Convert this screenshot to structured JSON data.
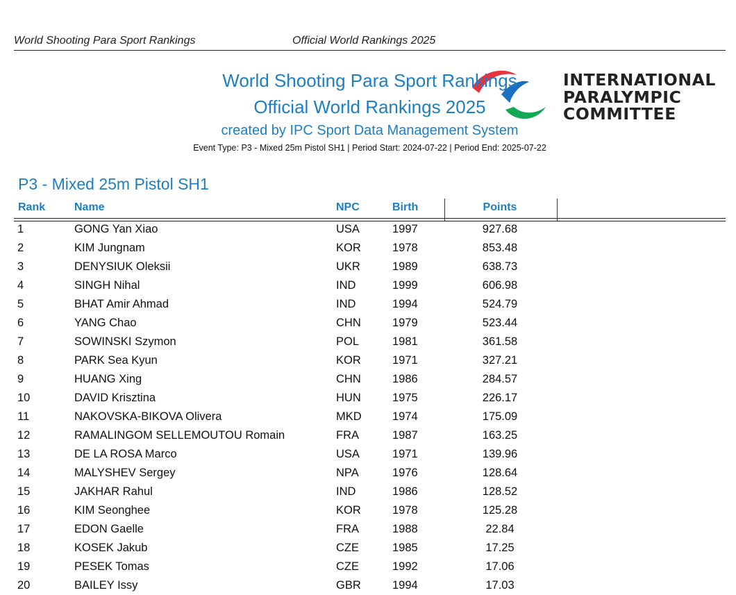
{
  "header": {
    "left_text": "World Shooting Para Sport Rankings",
    "center_text": "Official World Rankings 2025"
  },
  "title": {
    "line1": "World Shooting Para Sport Rankings",
    "line2": "Official World Rankings 2025",
    "line3": "created by IPC Sport Data Management System",
    "event_info": "Event Type: P3 - Mixed 25m Pistol SH1 | Period Start: 2024-07-22 | Period End: 2025-07-22"
  },
  "logo": {
    "lines": [
      "INTERNATIONAL",
      "PARALYMPIC",
      "COMMITTEE"
    ],
    "colors": {
      "red": "#e8333f",
      "blue": "#1e6fc0",
      "green": "#12a854"
    }
  },
  "section": {
    "title": "P3 - Mixed 25m Pistol SH1"
  },
  "table": {
    "columns": {
      "rank": "Rank",
      "name": "Name",
      "npc": "NPC",
      "birth": "Birth",
      "points": "Points"
    },
    "rows": [
      {
        "rank": "1",
        "name": "GONG Yan Xiao",
        "npc": "USA",
        "birth": "1997",
        "points": "927.68"
      },
      {
        "rank": "2",
        "name": "KIM Jungnam",
        "npc": "KOR",
        "birth": "1978",
        "points": "853.48"
      },
      {
        "rank": "3",
        "name": "DENYSIUK Oleksii",
        "npc": "UKR",
        "birth": "1989",
        "points": "638.73"
      },
      {
        "rank": "4",
        "name": "SINGH Nihal",
        "npc": "IND",
        "birth": "1999",
        "points": "606.98"
      },
      {
        "rank": "5",
        "name": "BHAT Amir Ahmad",
        "npc": "IND",
        "birth": "1994",
        "points": "524.79"
      },
      {
        "rank": "6",
        "name": "YANG Chao",
        "npc": "CHN",
        "birth": "1979",
        "points": "523.44"
      },
      {
        "rank": "7",
        "name": "SOWINSKI Szymon",
        "npc": "POL",
        "birth": "1981",
        "points": "361.58"
      },
      {
        "rank": "8",
        "name": "PARK Sea Kyun",
        "npc": "KOR",
        "birth": "1971",
        "points": "327.21"
      },
      {
        "rank": "9",
        "name": "HUANG Xing",
        "npc": "CHN",
        "birth": "1986",
        "points": "284.57"
      },
      {
        "rank": "10",
        "name": "DAVID Krisztina",
        "npc": "HUN",
        "birth": "1975",
        "points": "226.17"
      },
      {
        "rank": "11",
        "name": "NAKOVSKA-BIKOVA Olivera",
        "npc": "MKD",
        "birth": "1974",
        "points": "175.09"
      },
      {
        "rank": "12",
        "name": "RAMALINGOM SELLEMOUTOU Romain",
        "npc": "FRA",
        "birth": "1987",
        "points": "163.25"
      },
      {
        "rank": "13",
        "name": "DE LA ROSA Marco",
        "npc": "USA",
        "birth": "1971",
        "points": "139.96"
      },
      {
        "rank": "14",
        "name": "MALYSHEV Sergey",
        "npc": "NPA",
        "birth": "1976",
        "points": "128.64"
      },
      {
        "rank": "15",
        "name": "JAKHAR Rahul",
        "npc": "IND",
        "birth": "1986",
        "points": "128.52"
      },
      {
        "rank": "16",
        "name": "KIM Seonghee",
        "npc": "KOR",
        "birth": "1978",
        "points": "125.28"
      },
      {
        "rank": "17",
        "name": "EDON Gaelle",
        "npc": "FRA",
        "birth": "1988",
        "points": "22.84"
      },
      {
        "rank": "18",
        "name": "KOSEK Jakub",
        "npc": "CZE",
        "birth": "1985",
        "points": "17.25"
      },
      {
        "rank": "19",
        "name": "PESEK Tomas",
        "npc": "CZE",
        "birth": "1992",
        "points": "17.06"
      },
      {
        "rank": "20",
        "name": "BAILEY Issy",
        "npc": "GBR",
        "birth": "1994",
        "points": "17.03"
      }
    ]
  }
}
